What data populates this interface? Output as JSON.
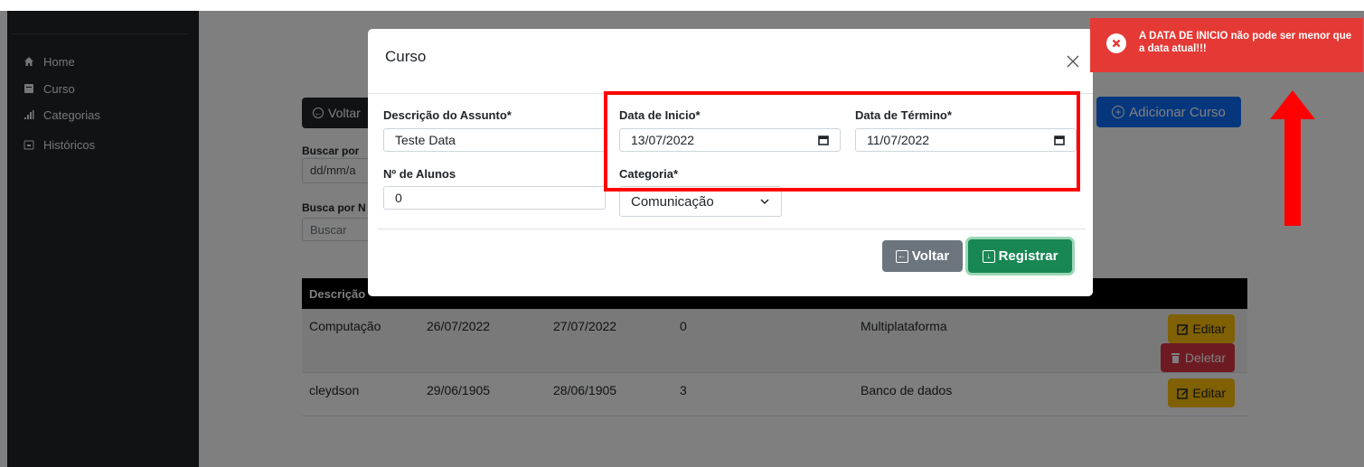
{
  "sidebar": {
    "items": [
      {
        "label": "Home",
        "icon": "home-icon"
      },
      {
        "label": "Curso",
        "icon": "book-icon"
      },
      {
        "label": "Categorias",
        "icon": "bar-chart-icon"
      },
      {
        "label": "Históricos",
        "icon": "calendar-icon"
      }
    ]
  },
  "main": {
    "back_label": "Voltar",
    "search_date_label": "Buscar por",
    "search_date_placeholder": "dd/mm/a",
    "search_name_label": "Busca por N",
    "search_name_placeholder": "Buscar",
    "add_course_label": "Adicionar Curso",
    "table": {
      "header_first": "Descrição",
      "rows": [
        {
          "descricao": "Computação",
          "inicio": "26/07/2022",
          "termino": "27/07/2022",
          "alunos": "0",
          "categoria": "Multiplataforma",
          "actions": [
            "Editar",
            "Deletar"
          ]
        },
        {
          "descricao": "cleydson",
          "inicio": "29/06/1905",
          "termino": "28/06/1905",
          "alunos": "3",
          "categoria": "Banco de dados",
          "actions": [
            "Editar"
          ]
        }
      ]
    }
  },
  "modal": {
    "title": "Curso",
    "fields": {
      "descricao_label": "Descrição do Assunto*",
      "descricao_value": "Teste Data",
      "data_inicio_label": "Data de Inicio*",
      "data_inicio_value": "13/07/2022",
      "data_termino_label": "Data de Término*",
      "data_termino_value": "11/07/2022",
      "alunos_label": "Nº de Alunos",
      "alunos_value": "0",
      "categoria_label": "Categoria*",
      "categoria_value": "Comunicação"
    },
    "voltar_label": "Voltar",
    "registrar_label": "Registrar"
  },
  "toast": {
    "message": "A DATA DE INICIO não pode ser menor que a data atual!!!",
    "color": "#e53935"
  },
  "colors": {
    "annotation": "#ff0000",
    "primary": "#0d6efd",
    "success": "#198754",
    "warning": "#ffc107",
    "danger": "#dc3545"
  }
}
